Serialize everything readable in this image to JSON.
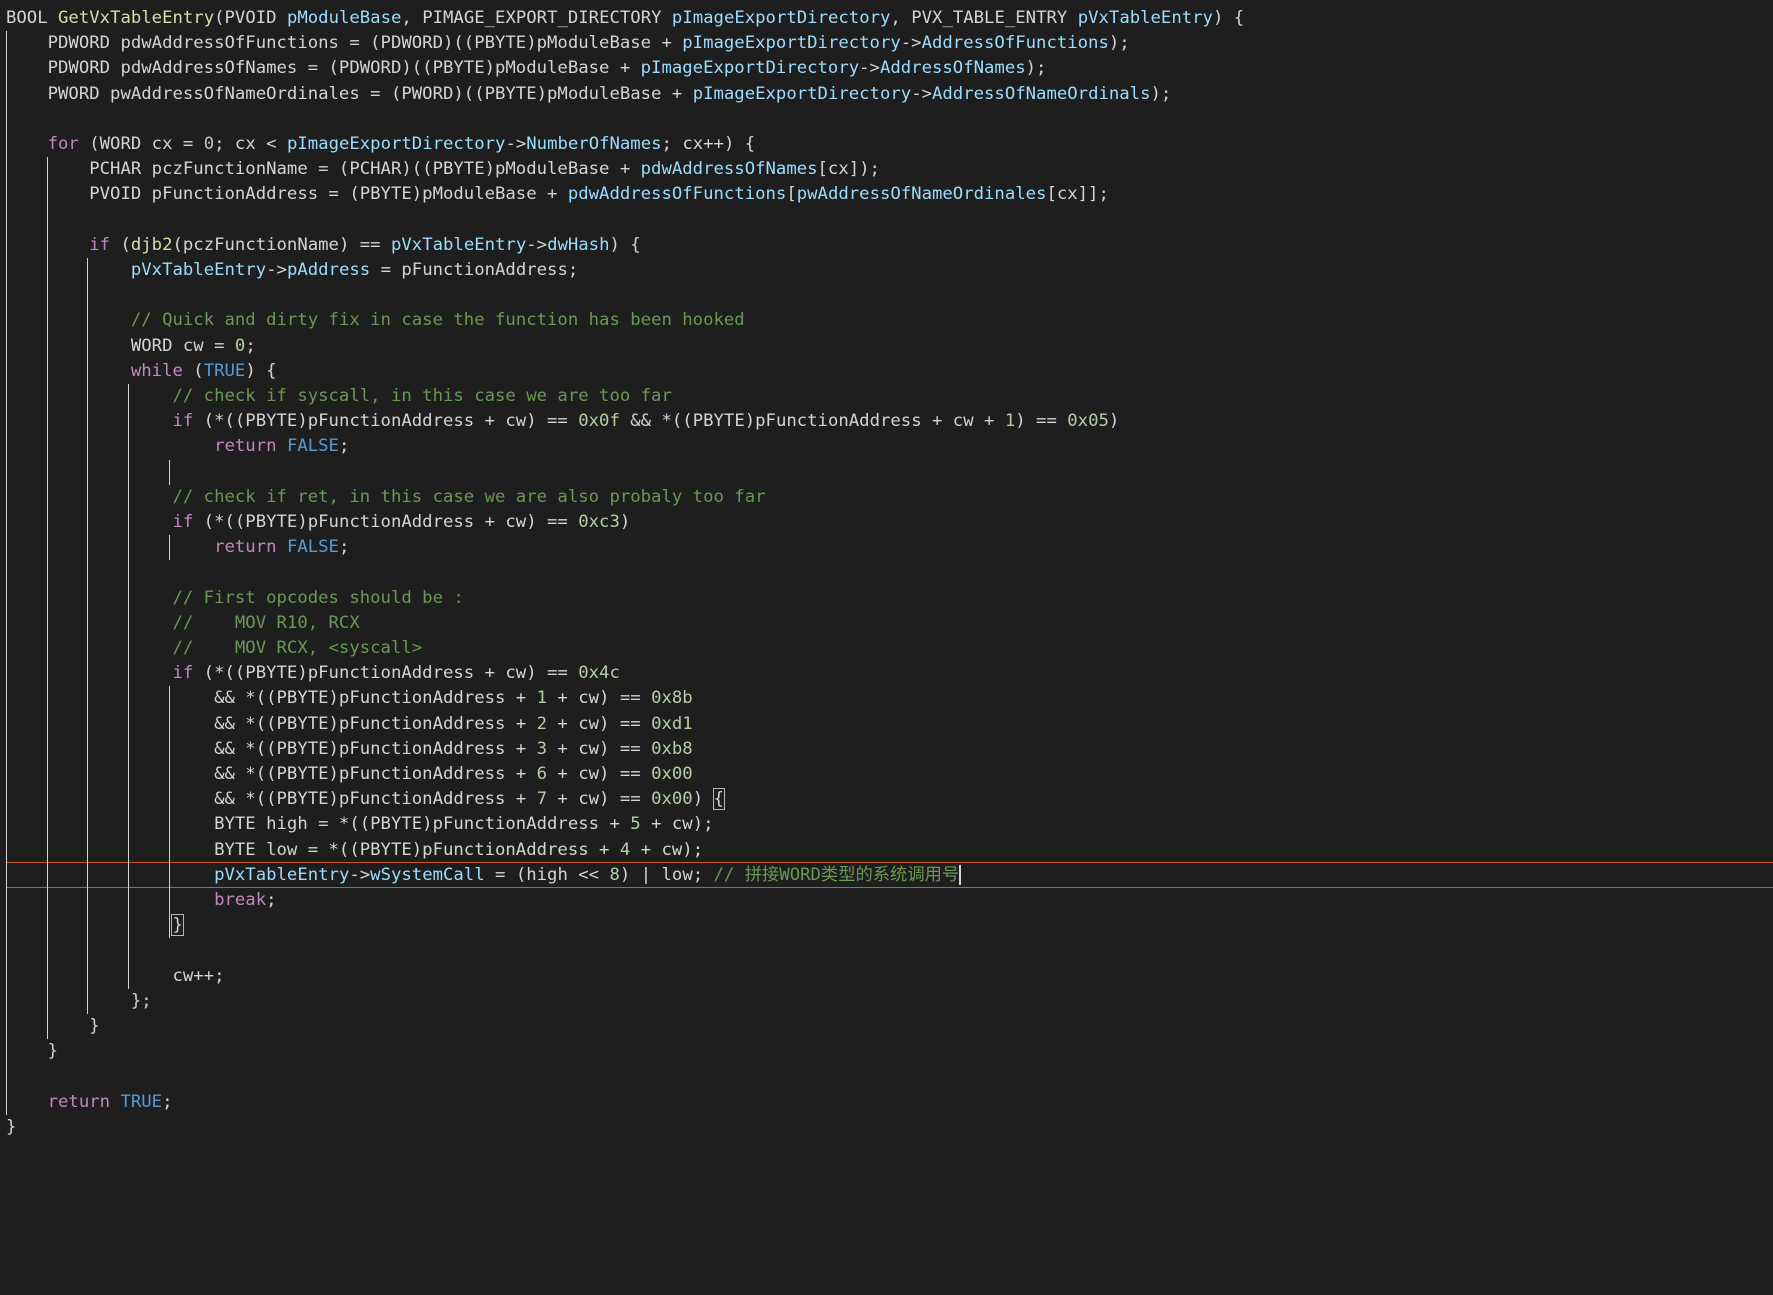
{
  "editor": {
    "lines": [
      [
        {
          "t": "BOOL ",
          "c": "t"
        },
        {
          "t": "GetVxTableEntry",
          "c": "f"
        },
        {
          "t": "(PVOID ",
          "c": "t"
        },
        {
          "t": "pModuleBase",
          "c": "v"
        },
        {
          "t": ", PIMAGE_EXPORT_DIRECTORY ",
          "c": "t"
        },
        {
          "t": "pImageExportDirectory",
          "c": "v"
        },
        {
          "t": ", PVX_TABLE_ENTRY ",
          "c": "t"
        },
        {
          "t": "pVxTableEntry",
          "c": "v"
        },
        {
          "t": ") {",
          "c": "t"
        }
      ],
      [
        {
          "t": "    PDWORD pdwAddressOfFunctions = (PDWORD)((PBYTE)pModuleBase + ",
          "c": "t"
        },
        {
          "t": "pImageExportDirectory",
          "c": "v"
        },
        {
          "t": "->",
          "c": "t"
        },
        {
          "t": "AddressOfFunctions",
          "c": "v"
        },
        {
          "t": ");",
          "c": "t"
        }
      ],
      [
        {
          "t": "    PDWORD pdwAddressOfNames = (PDWORD)((PBYTE)pModuleBase + ",
          "c": "t"
        },
        {
          "t": "pImageExportDirectory",
          "c": "v"
        },
        {
          "t": "->",
          "c": "t"
        },
        {
          "t": "AddressOfNames",
          "c": "v"
        },
        {
          "t": ");",
          "c": "t"
        }
      ],
      [
        {
          "t": "    PWORD pwAddressOfNameOrdinales = (PWORD)((PBYTE)pModuleBase + ",
          "c": "t"
        },
        {
          "t": "pImageExportDirectory",
          "c": "v"
        },
        {
          "t": "->",
          "c": "t"
        },
        {
          "t": "AddressOfNameOrdinals",
          "c": "v"
        },
        {
          "t": ");",
          "c": "t"
        }
      ],
      [],
      [
        {
          "t": "    ",
          "c": "t"
        },
        {
          "t": "for",
          "c": "c"
        },
        {
          "t": " (WORD cx = ",
          "c": "t"
        },
        {
          "t": "0",
          "c": "n"
        },
        {
          "t": "; cx < ",
          "c": "t"
        },
        {
          "t": "pImageExportDirectory",
          "c": "v"
        },
        {
          "t": "->",
          "c": "t"
        },
        {
          "t": "NumberOfNames",
          "c": "v"
        },
        {
          "t": "; cx++) {",
          "c": "t"
        }
      ],
      [
        {
          "t": "        PCHAR pczFunctionName = (PCHAR)((PBYTE)pModuleBase + ",
          "c": "t"
        },
        {
          "t": "pdwAddressOfNames",
          "c": "v"
        },
        {
          "t": "[cx]);",
          "c": "t"
        }
      ],
      [
        {
          "t": "        PVOID pFunctionAddress = (PBYTE)pModuleBase + ",
          "c": "t"
        },
        {
          "t": "pdwAddressOfFunctions",
          "c": "v"
        },
        {
          "t": "[",
          "c": "t"
        },
        {
          "t": "pwAddressOfNameOrdinales",
          "c": "v"
        },
        {
          "t": "[cx]];",
          "c": "t"
        }
      ],
      [],
      [
        {
          "t": "        ",
          "c": "t"
        },
        {
          "t": "if",
          "c": "c"
        },
        {
          "t": " (",
          "c": "t"
        },
        {
          "t": "djb2",
          "c": "f"
        },
        {
          "t": "(pczFunctionName) == ",
          "c": "t"
        },
        {
          "t": "pVxTableEntry",
          "c": "v"
        },
        {
          "t": "->",
          "c": "t"
        },
        {
          "t": "dwHash",
          "c": "v"
        },
        {
          "t": ") {",
          "c": "t"
        }
      ],
      [
        {
          "t": "            ",
          "c": "t"
        },
        {
          "t": "pVxTableEntry",
          "c": "v"
        },
        {
          "t": "->",
          "c": "t"
        },
        {
          "t": "pAddress",
          "c": "v"
        },
        {
          "t": " = pFunctionAddress;",
          "c": "t"
        }
      ],
      [],
      [
        {
          "t": "            ",
          "c": "t"
        },
        {
          "t": "// Quick and dirty fix in case the function has been hooked",
          "c": "m"
        }
      ],
      [
        {
          "t": "            WORD cw = ",
          "c": "t"
        },
        {
          "t": "0",
          "c": "n"
        },
        {
          "t": ";",
          "c": "t"
        }
      ],
      [
        {
          "t": "            ",
          "c": "t"
        },
        {
          "t": "while",
          "c": "c"
        },
        {
          "t": " (",
          "c": "t"
        },
        {
          "t": "TRUE",
          "c": "k"
        },
        {
          "t": ") {",
          "c": "t"
        }
      ],
      [
        {
          "t": "                ",
          "c": "t"
        },
        {
          "t": "// check if syscall, in this case we are too far",
          "c": "m"
        }
      ],
      [
        {
          "t": "                ",
          "c": "t"
        },
        {
          "t": "if",
          "c": "c"
        },
        {
          "t": " (*((PBYTE)pFunctionAddress + cw) == ",
          "c": "t"
        },
        {
          "t": "0x0f",
          "c": "n"
        },
        {
          "t": " && *((PBYTE)pFunctionAddress + cw + ",
          "c": "t"
        },
        {
          "t": "1",
          "c": "n"
        },
        {
          "t": ") == ",
          "c": "t"
        },
        {
          "t": "0x05",
          "c": "n"
        },
        {
          "t": ")",
          "c": "t"
        }
      ],
      [
        {
          "t": "                    ",
          "c": "t"
        },
        {
          "t": "return",
          "c": "c"
        },
        {
          "t": " ",
          "c": "t"
        },
        {
          "t": "FALSE",
          "c": "k"
        },
        {
          "t": ";",
          "c": "t"
        }
      ],
      [],
      [
        {
          "t": "                ",
          "c": "t"
        },
        {
          "t": "// check if ret, in this case we are also probaly too far",
          "c": "m"
        }
      ],
      [
        {
          "t": "                ",
          "c": "t"
        },
        {
          "t": "if",
          "c": "c"
        },
        {
          "t": " (*((PBYTE)pFunctionAddress + cw) == ",
          "c": "t"
        },
        {
          "t": "0xc3",
          "c": "n"
        },
        {
          "t": ")",
          "c": "t"
        }
      ],
      [
        {
          "t": "                    ",
          "c": "t"
        },
        {
          "t": "return",
          "c": "c"
        },
        {
          "t": " ",
          "c": "t"
        },
        {
          "t": "FALSE",
          "c": "k"
        },
        {
          "t": ";",
          "c": "t"
        }
      ],
      [],
      [
        {
          "t": "                ",
          "c": "t"
        },
        {
          "t": "// First opcodes should be :",
          "c": "m"
        }
      ],
      [
        {
          "t": "                ",
          "c": "t"
        },
        {
          "t": "//    MOV R10, RCX",
          "c": "m"
        }
      ],
      [
        {
          "t": "                ",
          "c": "t"
        },
        {
          "t": "//    MOV RCX, <syscall>",
          "c": "m"
        }
      ],
      [
        {
          "t": "                ",
          "c": "t"
        },
        {
          "t": "if",
          "c": "c"
        },
        {
          "t": " (*((PBYTE)pFunctionAddress + cw) == ",
          "c": "t"
        },
        {
          "t": "0x4c",
          "c": "n"
        }
      ],
      [
        {
          "t": "                    && *((PBYTE)pFunctionAddress + ",
          "c": "t"
        },
        {
          "t": "1",
          "c": "n"
        },
        {
          "t": " + cw) == ",
          "c": "t"
        },
        {
          "t": "0x8b",
          "c": "n"
        }
      ],
      [
        {
          "t": "                    && *((PBYTE)pFunctionAddress + ",
          "c": "t"
        },
        {
          "t": "2",
          "c": "n"
        },
        {
          "t": " + cw) == ",
          "c": "t"
        },
        {
          "t": "0xd1",
          "c": "n"
        }
      ],
      [
        {
          "t": "                    && *((PBYTE)pFunctionAddress + ",
          "c": "t"
        },
        {
          "t": "3",
          "c": "n"
        },
        {
          "t": " + cw) == ",
          "c": "t"
        },
        {
          "t": "0xb8",
          "c": "n"
        }
      ],
      [
        {
          "t": "                    && *((PBYTE)pFunctionAddress + ",
          "c": "t"
        },
        {
          "t": "6",
          "c": "n"
        },
        {
          "t": " + cw) == ",
          "c": "t"
        },
        {
          "t": "0x00",
          "c": "n"
        }
      ],
      [
        {
          "t": "                    && *((PBYTE)pFunctionAddress + ",
          "c": "t"
        },
        {
          "t": "7",
          "c": "n"
        },
        {
          "t": " + cw) == ",
          "c": "t"
        },
        {
          "t": "0x00",
          "c": "n"
        },
        {
          "t": ") ",
          "c": "t"
        },
        {
          "t": "{",
          "c": "t",
          "b": true
        }
      ],
      [
        {
          "t": "                    BYTE high = *((PBYTE)pFunctionAddress + ",
          "c": "t"
        },
        {
          "t": "5",
          "c": "n"
        },
        {
          "t": " + cw);",
          "c": "t"
        }
      ],
      [
        {
          "t": "                    BYTE low = *((PBYTE)pFunctionAddress + ",
          "c": "t"
        },
        {
          "t": "4",
          "c": "n"
        },
        {
          "t": " + cw);",
          "c": "t"
        }
      ],
      [
        {
          "t": "                    ",
          "c": "t"
        },
        {
          "t": "pVxTableEntry",
          "c": "v"
        },
        {
          "t": "->",
          "c": "t"
        },
        {
          "t": "wSystemCall",
          "c": "v"
        },
        {
          "t": " = (high << ",
          "c": "t"
        },
        {
          "t": "8",
          "c": "n"
        },
        {
          "t": ") | low; ",
          "c": "t"
        },
        {
          "t": "// 拼接WORD类型的系统调用号",
          "c": "m"
        }
      ],
      [
        {
          "t": "                    ",
          "c": "t"
        },
        {
          "t": "break",
          "c": "c"
        },
        {
          "t": ";",
          "c": "t"
        }
      ],
      [
        {
          "t": "                ",
          "c": "t"
        },
        {
          "t": "}",
          "c": "t",
          "b": true
        }
      ],
      [],
      [
        {
          "t": "                cw++;",
          "c": "t"
        }
      ],
      [
        {
          "t": "            };",
          "c": "t"
        }
      ],
      [
        {
          "t": "        }",
          "c": "t"
        }
      ],
      [
        {
          "t": "    }",
          "c": "t"
        }
      ],
      [],
      [
        {
          "t": "    ",
          "c": "t"
        },
        {
          "t": "return",
          "c": "c"
        },
        {
          "t": " ",
          "c": "t"
        },
        {
          "t": "TRUE",
          "c": "k"
        },
        {
          "t": ";",
          "c": "t"
        }
      ],
      [
        {
          "t": "}",
          "c": "t"
        }
      ]
    ],
    "current_line": 34,
    "colors": {
      "background": "#1e1e1e",
      "text": "#d4d4d4",
      "keyword": "#569cd6",
      "control": "#c586c0",
      "function": "#dcdcaa",
      "variable": "#9cdcfe",
      "number": "#b5cea8",
      "comment": "#6a9955",
      "current_line_border": "#c75a25"
    }
  }
}
